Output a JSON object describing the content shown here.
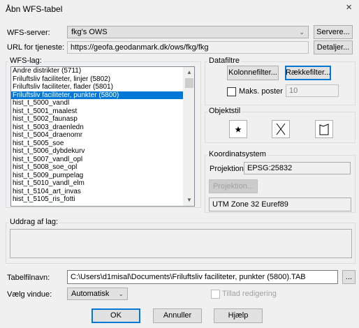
{
  "window": {
    "title": "Åbn WFS-tabel",
    "close_glyph": "×"
  },
  "server": {
    "label": "WFS-server:",
    "value": "fkg's OWS",
    "button": "Servere..."
  },
  "url": {
    "label": "URL for tjeneste:",
    "value": "https://geofa.geodanmark.dk/ows/fkg/fkg",
    "button": "Detaljer..."
  },
  "layers": {
    "label": "WFS-lag:",
    "items": [
      "Andre distrikter (5711)",
      "Friluftsliv faciliteter,  linjer (5802)",
      "Friluftsliv faciliteter, flader (5801)",
      "Friluftsliv faciliteter, punkter (5800)",
      "hist_t_5000_vandl",
      "hist_t_5001_maalest",
      "hist_t_5002_faunasp",
      "hist_t_5003_draenledn",
      "hist_t_5004_draenomr",
      "hist_t_5005_soe",
      "hist_t_5006_dybdekurv",
      "hist_t_5007_vandl_opl",
      "hist_t_5008_soe_opl",
      "hist_t_5009_pumpelag",
      "hist_t_5010_vandl_elm",
      "hist_t_5104_art_invas",
      "hist_t_5105_ris_fotti"
    ],
    "selected_index": 3
  },
  "datafiltre": {
    "label": "Datafiltre",
    "column_filter": "Kolonnefilter...",
    "row_filter": "Rækkefilter...",
    "max_label": "Maks. poster",
    "max_value": "10"
  },
  "objektstil": {
    "label": "Objektstil",
    "icons": [
      "star-symbol-icon",
      "cross-line-icon",
      "region-fill-icon"
    ]
  },
  "koordinatsystem": {
    "label": "Koordinatsystem",
    "projection_label": "Projektion",
    "projection_value": "EPSG:25832",
    "projection_button": "Projektion...",
    "description": "UTM Zone 32 Euref89"
  },
  "extract": {
    "label": "Uddrag af lag:"
  },
  "filename": {
    "label": "Tabelfilnavn:",
    "value": "C:\\Users\\d1misal\\Documents\\Friluftsliv faciliteter, punkter (5800).TAB",
    "button": "..."
  },
  "window_select": {
    "label": "Vælg vindue:",
    "value": "Automatisk",
    "allow_edit": "Tillad redigering"
  },
  "buttons": {
    "ok": "OK",
    "cancel": "Annuller",
    "help": "Hjælp"
  },
  "colors": {
    "selection": "#0078d7",
    "dialog_bg": "#f0f0f0"
  }
}
